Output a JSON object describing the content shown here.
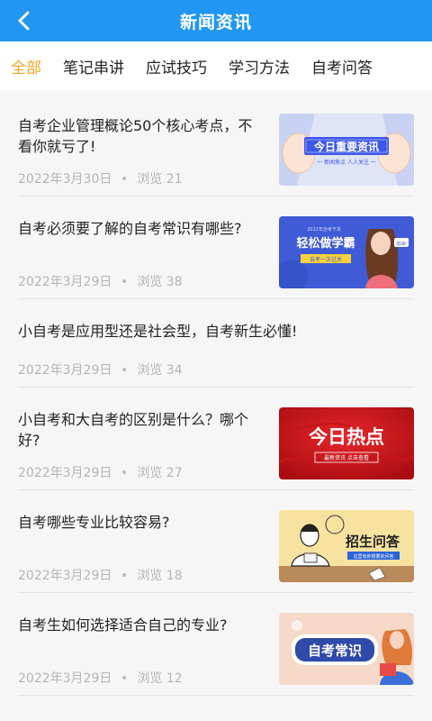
{
  "header": {
    "title": "新闻资讯",
    "back_icon": "chevron-left-icon"
  },
  "tabs": [
    {
      "label": "全部",
      "active": true
    },
    {
      "label": "笔记串讲",
      "active": false
    },
    {
      "label": "应试技巧",
      "active": false
    },
    {
      "label": "学习方法",
      "active": false
    },
    {
      "label": "自考问答",
      "active": false
    }
  ],
  "colors": {
    "header": "#2196f3",
    "active_tab": "#f5a623"
  },
  "articles": [
    {
      "title": "自考企业管理概论50个核心考点，不看你就亏了!",
      "date": "2022年3月30日",
      "views": "浏览 21",
      "thumb": {
        "main_text": "今日重要资讯",
        "sub_text": "一 新闻焦点 人人关注 一"
      }
    },
    {
      "title": "自考必须要了解的自考常识有哪些?",
      "date": "2022年3月29日",
      "views": "浏览 38",
      "thumb": {
        "top_text": "2022年自考干货",
        "main_text": "轻松做学霸",
        "sub_text": "自考一次过关",
        "bubble": "加油!"
      }
    },
    {
      "title": "小自考是应用型还是社会型，自考新生必懂!",
      "date": "2022年3月29日",
      "views": "浏览 34",
      "thumb": null
    },
    {
      "title": "小自考和大自考的区别是什么？哪个好?",
      "date": "2022年3月29日",
      "views": "浏览 27",
      "thumb": {
        "main_text": "今日热点",
        "sub_text": "最新资讯 点击查看"
      }
    },
    {
      "title": "自考哪些专业比较容易?",
      "date": "2022年3月29日",
      "views": "浏览 18",
      "thumb": {
        "main_text": "招生问答",
        "sub_text": "这里有你想要的问答"
      }
    },
    {
      "title": "自考生如何选择适合自己的专业?",
      "date": "2022年3月29日",
      "views": "浏览 12",
      "thumb": {
        "main_text": "自考常识"
      }
    }
  ]
}
